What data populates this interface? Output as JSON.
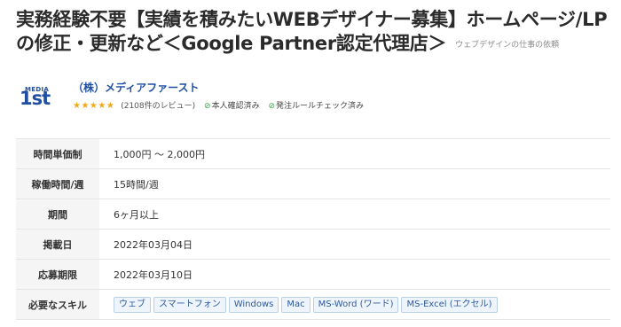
{
  "job": {
    "title": "実務経験不要【実績を積みたいWEBデザイナー募集】ホームページ/LPの修正・更新など＜Google Partner認定代理店＞",
    "category": "ウェブデザインの仕事の依頼"
  },
  "client": {
    "logo_text_top": "MEDIA",
    "logo_text_main": "1st",
    "name": "（株）メディアファースト",
    "rating_stars": "★★★★★",
    "rating": 5,
    "review_count": "(2108件のレビュー)",
    "badges": [
      "本人確認済み",
      "発注ルールチェック済み"
    ],
    "badge_icon": "check-circle-icon"
  },
  "details": [
    {
      "label": "時間単価制",
      "value": "1,000円 ～ 2,000円"
    },
    {
      "label": "稼働時間/週",
      "value": "15時間/週"
    },
    {
      "label": "期間",
      "value": "6ヶ月以上"
    },
    {
      "label": "掲載日",
      "value": "2022年03月04日"
    },
    {
      "label": "応募期限",
      "value": "2022年03月10日"
    }
  ],
  "skills": {
    "label": "必要なスキル",
    "tags": [
      "ウェブ",
      "スマートフォン",
      "Windows",
      "Mac",
      "MS-Word (ワード)",
      "MS-Excel (エクセル)"
    ]
  },
  "colors": {
    "brand_blue": "#1f4fa3",
    "star": "#f0a81b",
    "check": "#38a548",
    "tag_border": "#b9cfe6",
    "label_bg": "#f5f5f5"
  }
}
